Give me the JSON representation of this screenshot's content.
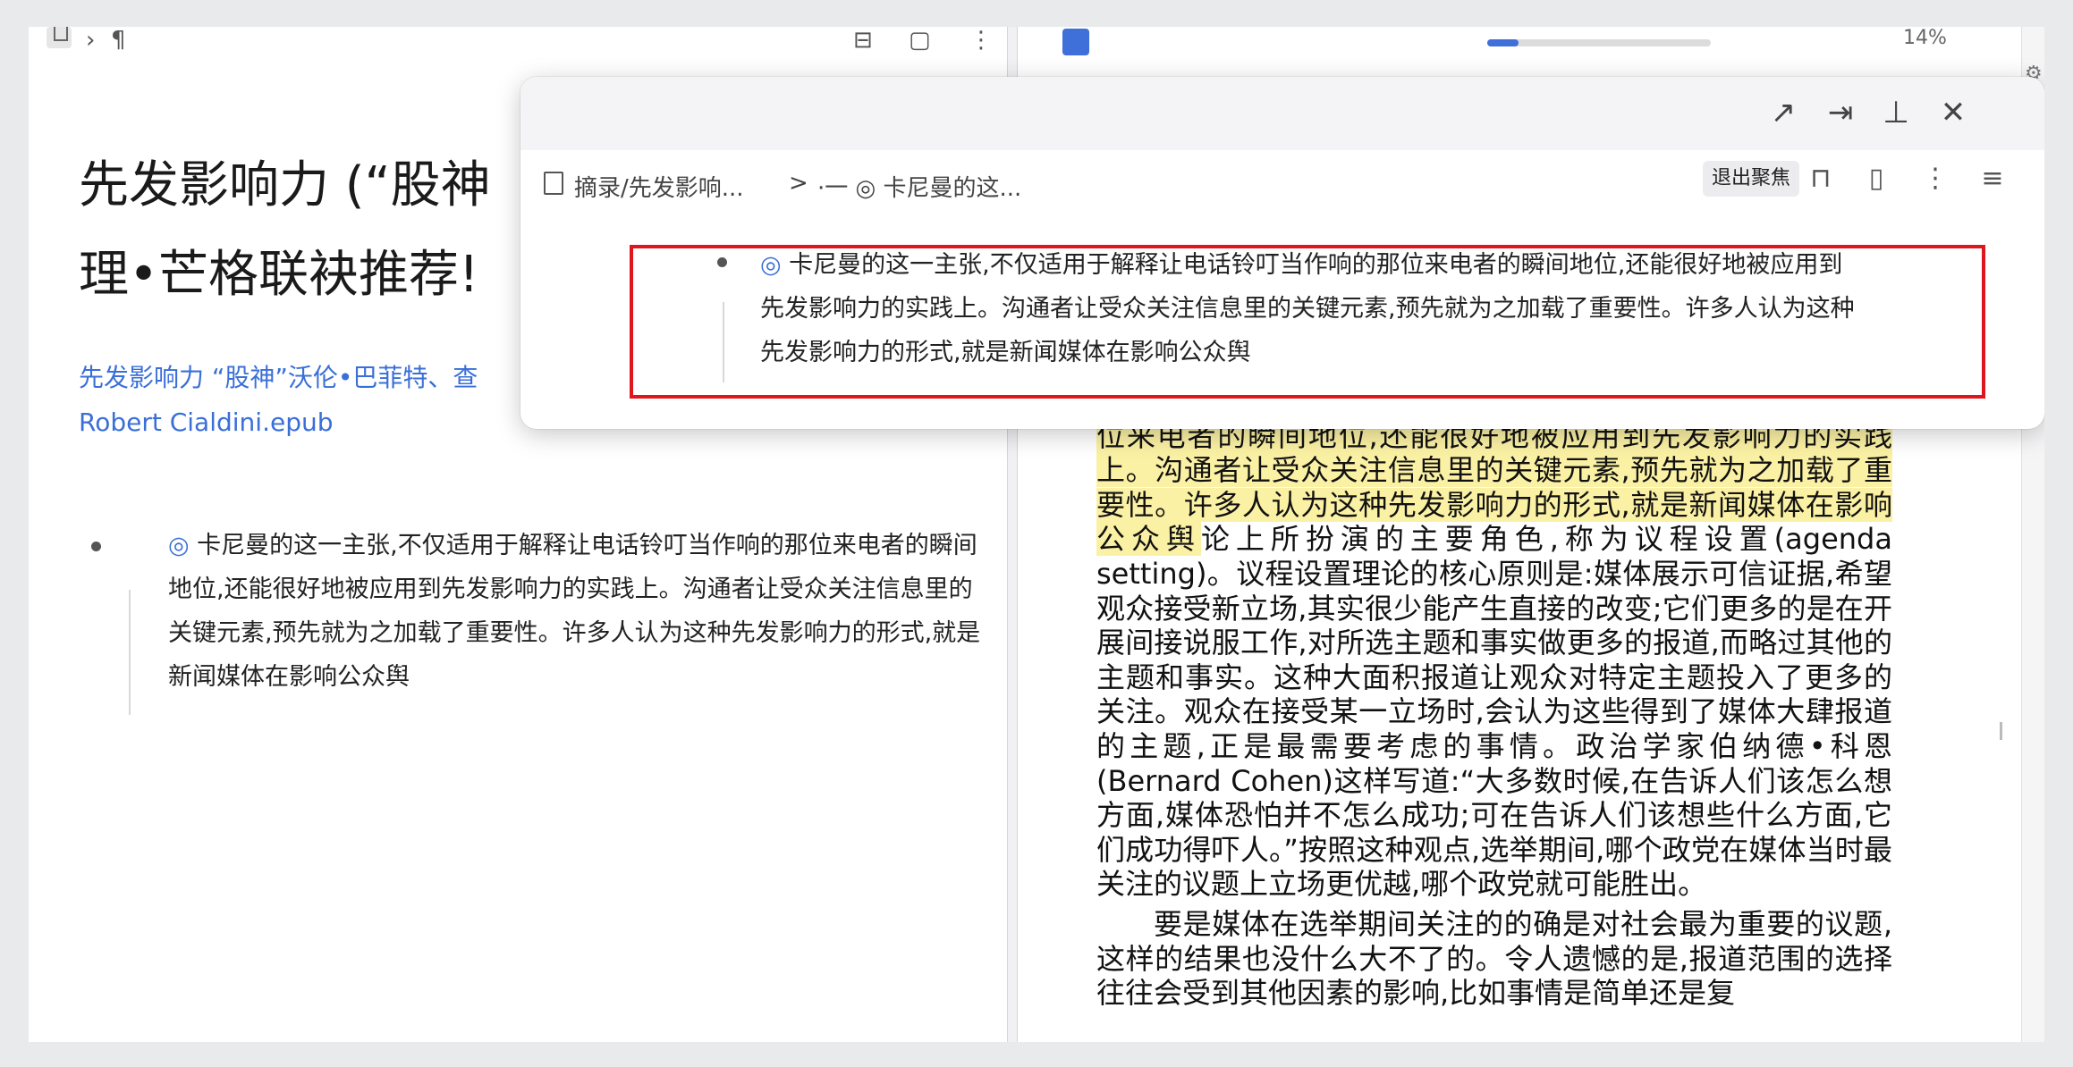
{
  "left": {
    "title": "先发影响力 (“股神 理•芒格联袂推荐!",
    "title_line1": "先发影响力 (“股神",
    "title_line2": "理•芒格联袂推荐!",
    "source_link_line1": "先发影响力 “股神”沃伦•巴菲特、查",
    "source_link_line2": "Robert Cialdini.epub",
    "block_icon": "◎",
    "block_text": "卡尼曼的这一主张,不仅适用于解释让电话铃叮当作响的那位来电者的瞬间地位,还能很好地被应用到先发影响力的实践上。沟通者让受众关注信息里的关键元素,预先就为之加载了重要性。许多人认为这种先发影响力的形式,就是新闻媒体在影响公众舆"
  },
  "reader": {
    "progress_label": "14%",
    "progress_value": 0.14,
    "highlighted": "卡尼曼的这一主张,不仅适用于解释让电话铃叮当作响的那位来电者的瞬间地位,还能很好地被应用到先发影响力的实践上。沟通者让受众关注信息里的关键元素,预先就为之加载了重要性。许多人认为这种先发影响力的形式,就是新闻媒体在影响公众舆",
    "para1_rest": "论上所扮演的主要角色,称为议程设置(agenda setting)。议程设置理论的核心原则是:媒体展示可信证据,希望观众接受新立场,其实很少能产生直接的改变;它们更多的是在开展间接说服工作,对所选主题和事实做更多的报道,而略过其他的主题和事实。这种大面积报道让观众对特定主题投入了更多的关注。观众在接受某一立场时,会认为这些得到了媒体大肆报道的主题,正是最需要考虑的事情。政治学家伯纳德•科恩(Bernard Cohen)这样写道:“大多数时候,在告诉人们该怎么想方面,媒体恐怕并不怎么成功;可在告诉人们该想些什么方面,它们成功得吓人。”按照这种观点,选举期间,哪个政党在媒体当时最关注的议题上立场更优越,哪个政党就可能胜出。",
    "para2": "要是媒体在选举期间关注的的确是对社会最为重要的议题,这样的结果也没什么大不了的。令人遗憾的是,报道范围的选择往往会受到其他因素的影响,比如事情是简单还是复"
  },
  "popup": {
    "breadcrumb_1": "摘录/先发影响...",
    "breadcrumb_sep": ">",
    "breadcrumb_2": "·一 ◎ 卡尼曼的这...",
    "exit_focus_label": "退出聚焦",
    "block_icon": "◎",
    "block_text": "卡尼曼的这一主张,不仅适用于解释让电话铃叮当作响的那位来电者的瞬间地位,还能很好地被应用到先发影响力的实践上。沟通者让受众关注信息里的关键元素,预先就为之加载了重要性。许多人认为这种先发影响力的形式,就是新闻媒体在影响公众舆",
    "icons": {
      "open": "arrow-up-right-icon",
      "move": "move-out-icon",
      "pin": "pin-icon",
      "close": "close-icon",
      "lock": "unlock-icon",
      "doc": "document-icon",
      "more": "more-vertical-icon",
      "outline": "outline-menu-icon"
    }
  },
  "colors": {
    "accent": "#3a6fd8",
    "highlight": "#fbf1a4",
    "focus_border": "#e0161d"
  }
}
